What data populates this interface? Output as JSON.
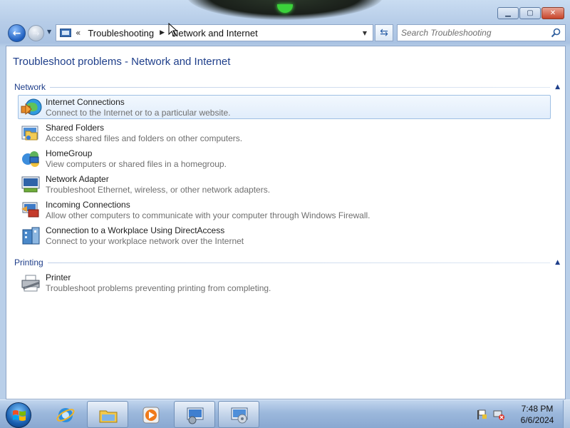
{
  "window": {
    "controls": {
      "minimize": "▁",
      "maximize": "▢",
      "close": "✕"
    }
  },
  "nav": {
    "back_glyph": "←",
    "forward_glyph": "→",
    "history_glyph": "▼",
    "address": {
      "icon": "control-panel-icon",
      "chevron": "«",
      "crumbs": [
        "Troubleshooting",
        "Network and Internet"
      ],
      "separator": "▶",
      "dropdown_glyph": "▼"
    },
    "refresh_glyph": "⇆",
    "search": {
      "placeholder": "Search Troubleshooting",
      "value": ""
    }
  },
  "content": {
    "title": "Troubleshoot problems - Network and Internet",
    "groups": [
      {
        "name": "Network",
        "collapse_glyph": "▲",
        "items": [
          {
            "title": "Internet Connections",
            "description": "Connect to the Internet or to a particular website.",
            "icon": "globe-network-icon",
            "selected": true
          },
          {
            "title": "Shared Folders",
            "description": "Access shared files and folders on other computers.",
            "icon": "shared-folder-icon",
            "selected": false
          },
          {
            "title": "HomeGroup",
            "description": "View computers or shared files in a homegroup.",
            "icon": "homegroup-icon",
            "selected": false
          },
          {
            "title": "Network Adapter",
            "description": "Troubleshoot Ethernet, wireless, or other network adapters.",
            "icon": "network-adapter-icon",
            "selected": false
          },
          {
            "title": "Incoming Connections",
            "description": "Allow other computers to communicate with your computer through Windows Firewall.",
            "icon": "incoming-connections-icon",
            "selected": false
          },
          {
            "title": "Connection to a Workplace Using DirectAccess",
            "description": "Connect to your workplace network over the Internet",
            "icon": "workplace-directaccess-icon",
            "selected": false
          }
        ]
      },
      {
        "name": "Printing",
        "collapse_glyph": "▲",
        "items": [
          {
            "title": "Printer",
            "description": "Troubleshoot problems preventing printing from completing.",
            "icon": "printer-icon",
            "selected": false
          }
        ]
      }
    ]
  },
  "taskbar": {
    "pinned": [
      "internet-explorer-icon",
      "windows-explorer-icon",
      "media-player-icon",
      "control-panel-icon",
      "troubleshooting-icon"
    ],
    "clock": {
      "time": "7:48 PM",
      "date": "6/6/2024"
    }
  },
  "colors": {
    "accent": "#1e3e8a",
    "selection_border": "#9fc0e4",
    "description_text": "#6f6f6f"
  }
}
